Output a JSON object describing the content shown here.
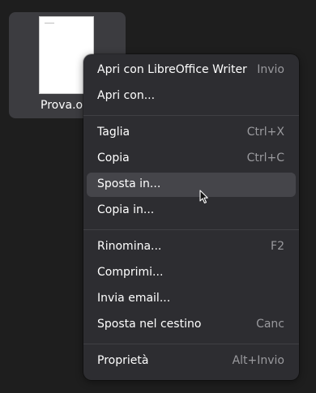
{
  "file": {
    "name": "Prova.o"
  },
  "menu": {
    "groups": [
      [
        {
          "label": "Apri con LibreOffice Writer",
          "accel": "Invio"
        },
        {
          "label": "Apri con...",
          "accel": ""
        }
      ],
      [
        {
          "label": "Taglia",
          "accel": "Ctrl+X"
        },
        {
          "label": "Copia",
          "accel": "Ctrl+C"
        },
        {
          "label": "Sposta in...",
          "accel": ""
        },
        {
          "label": "Copia in...",
          "accel": ""
        }
      ],
      [
        {
          "label": "Rinomina...",
          "accel": "F2"
        },
        {
          "label": "Comprimi...",
          "accel": ""
        },
        {
          "label": "Invia email...",
          "accel": ""
        },
        {
          "label": "Sposta nel cestino",
          "accel": "Canc"
        }
      ],
      [
        {
          "label": "Proprietà",
          "accel": "Alt+Invio"
        }
      ]
    ]
  },
  "colors": {
    "desktop_bg": "#1e1e1e",
    "tile_bg": "#3c3c40",
    "menu_bg": "#2d2d31",
    "hover_bg": "#45454a",
    "text": "#ffffff",
    "accel_text": "#9a9a9e"
  }
}
